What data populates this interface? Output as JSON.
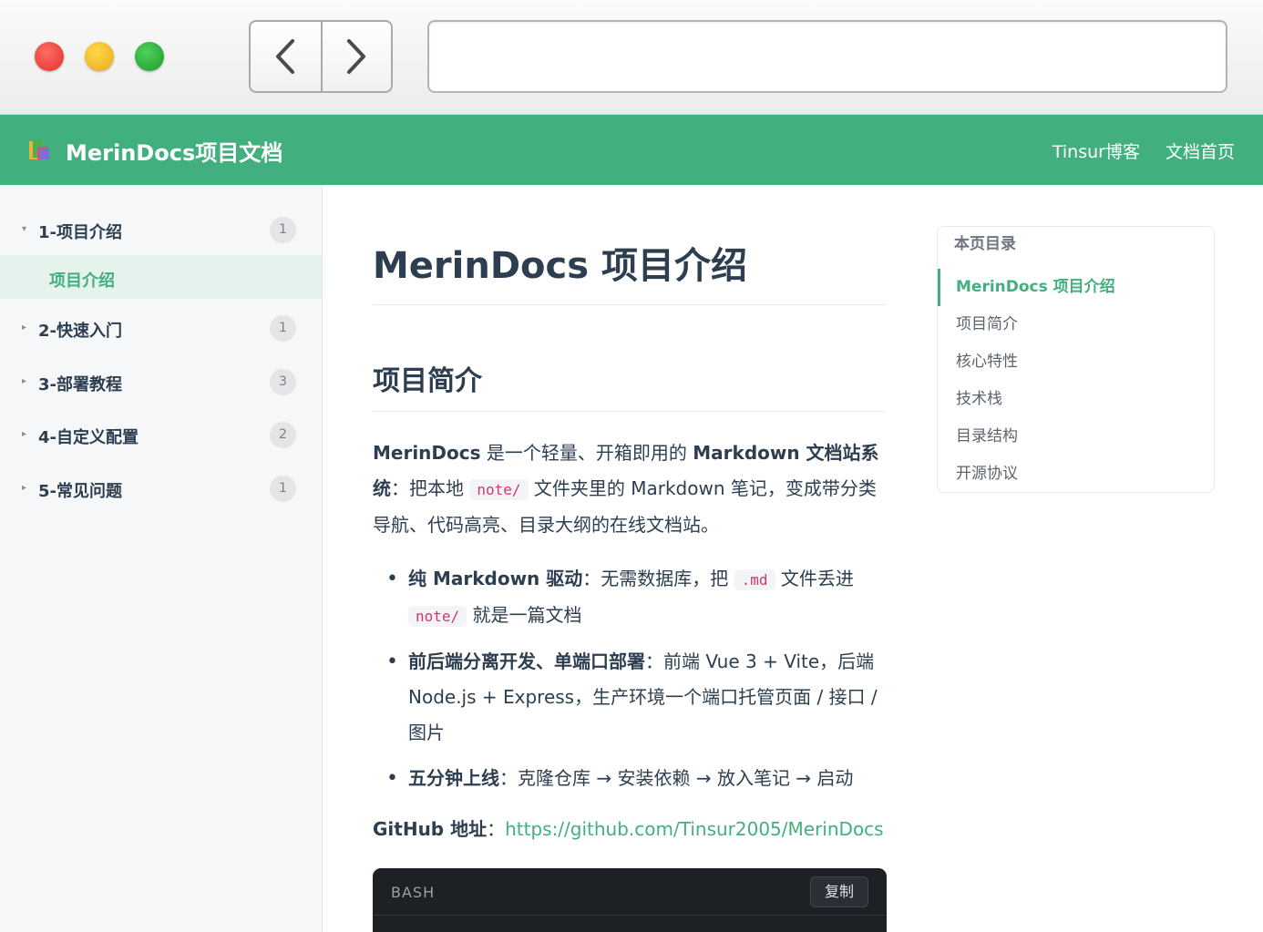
{
  "header": {
    "brand": "MerinDocs项目文档",
    "links": [
      "Tinsur博客",
      "文档首页"
    ]
  },
  "sidebar": {
    "groups": [
      {
        "label": "1-项目介绍",
        "count": "1",
        "expanded": true,
        "children": [
          {
            "label": "项目介绍",
            "active": true
          }
        ]
      },
      {
        "label": "2-快速入门",
        "count": "1",
        "expanded": false
      },
      {
        "label": "3-部署教程",
        "count": "3",
        "expanded": false
      },
      {
        "label": "4-自定义配置",
        "count": "2",
        "expanded": false
      },
      {
        "label": "5-常见问题",
        "count": "1",
        "expanded": false
      }
    ]
  },
  "main": {
    "title": "MerinDocs 项目介绍",
    "section_title": "项目简介",
    "intro": {
      "name": "MerinDocs",
      "t1": " 是一个轻量、开箱即用的 ",
      "strong": "Markdown 文档站系统",
      "t2": "：把本地 ",
      "code": "note/",
      "t3": " 文件夹里的 Markdown 笔记，变成带分类导航、代码高亮、目录大纲的在线文档站。"
    },
    "bullets": [
      {
        "strong": "纯 Markdown 驱动",
        "t1": "：无需数据库，把 ",
        "code1": ".md",
        "t2": " 文件丢进 ",
        "code2": "note/",
        "t3": " 就是一篇文档"
      },
      {
        "strong": "前后端分离开发、单端口部署",
        "text": "：前端 Vue 3 + Vite，后端 Node.js + Express，生产环境一个端口托管页面 / 接口 / 图片"
      },
      {
        "strong": "五分钟上线",
        "text": "：克隆仓库 → 安装依赖 → 放入笔记 → 启动"
      }
    ],
    "github": {
      "label": "GitHub 地址",
      "sep": "：",
      "url": "https://github.com/Tinsur2005/MerinDocs"
    },
    "code_block": {
      "lang": "BASH",
      "copy_label": "复制"
    }
  },
  "toc": {
    "title": "本页目录",
    "items": [
      "MerinDocs 项目介绍",
      "项目简介",
      "核心特性",
      "技术栈",
      "目录结构",
      "开源协议"
    ],
    "active": "MerinDocs 项目介绍"
  },
  "colors": {
    "accent": "#42b07e",
    "text": "#2c3e50",
    "code_pink": "#d1376b",
    "code_bg": "#1d2025"
  },
  "icons": [
    "back-chevron-icon",
    "forward-chevron-icon",
    "logo-icon",
    "caret-down-icon",
    "caret-right-icon"
  ]
}
